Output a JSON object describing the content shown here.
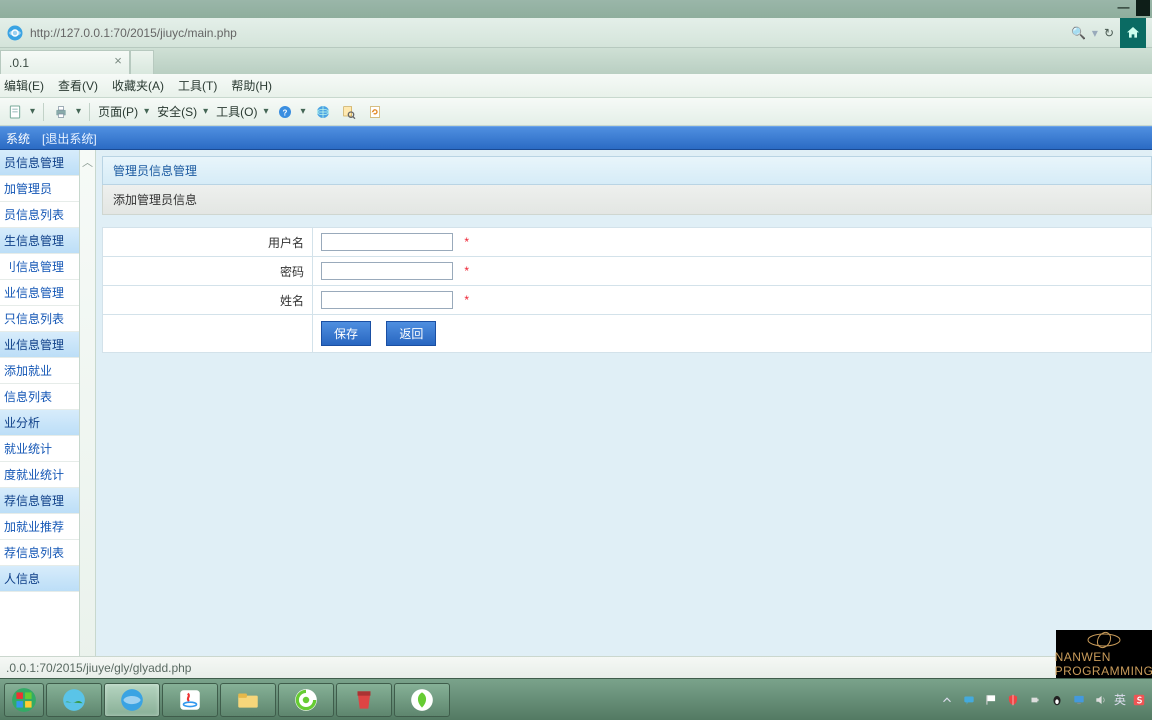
{
  "window": {
    "min": "—"
  },
  "addressbar": {
    "url": "http://127.0.0.1:70/2015/jiuyc/main.php",
    "search_glyph": "🔍",
    "refresh_glyph": "↻"
  },
  "tab": {
    "title": ".0.1",
    "close": "×"
  },
  "menubar": {
    "edit": "编辑(E)",
    "view": "查看(V)",
    "favorites": "收藏夹(A)",
    "tools": "工具(T)",
    "help": "帮助(H)"
  },
  "toolbar": {
    "page": "页面(P)",
    "safety": "安全(S)",
    "tools": "工具(O)",
    "drop": "▾"
  },
  "sysbar": {
    "system": "系统",
    "logout": "[退出系统]"
  },
  "sidebar": {
    "items": [
      {
        "label": "员信息管理",
        "group": true
      },
      {
        "label": "加管理员",
        "group": false
      },
      {
        "label": "员信息列表",
        "group": false
      },
      {
        "label": "生信息管理",
        "group": true
      },
      {
        "label": "刂信息管理",
        "group": false
      },
      {
        "label": "业信息管理",
        "group": false
      },
      {
        "label": "只信息列表",
        "group": false
      },
      {
        "label": "业信息管理",
        "group": true
      },
      {
        "label": "添加就业",
        "group": false
      },
      {
        "label": "信息列表",
        "group": false
      },
      {
        "label": "业分析",
        "group": true
      },
      {
        "label": "就业统计",
        "group": false
      },
      {
        "label": "度就业统计",
        "group": false
      },
      {
        "label": "荐信息管理",
        "group": true
      },
      {
        "label": "加就业推荐",
        "group": false
      },
      {
        "label": "荐信息列表",
        "group": false
      },
      {
        "label": "人信息",
        "group": true
      }
    ],
    "chev_up": "︿",
    "chev_down": "﹀"
  },
  "panel": {
    "title": "管理员信息管理",
    "subtitle": "添加管理员信息"
  },
  "form": {
    "username_label": "用户名",
    "username_value": "",
    "username_star": "*",
    "password_label": "密码",
    "password_value": "",
    "password_star": "*",
    "name_label": "姓名",
    "name_value": "",
    "name_star": "*",
    "save": "保存",
    "back": "返回"
  },
  "status": {
    "text": ".0.0.1:70/2015/jiuye/gly/glyadd.php"
  },
  "watermark": {
    "line2": "NANWEN PROGRAMMING"
  },
  "tray": {
    "ime": "英"
  }
}
